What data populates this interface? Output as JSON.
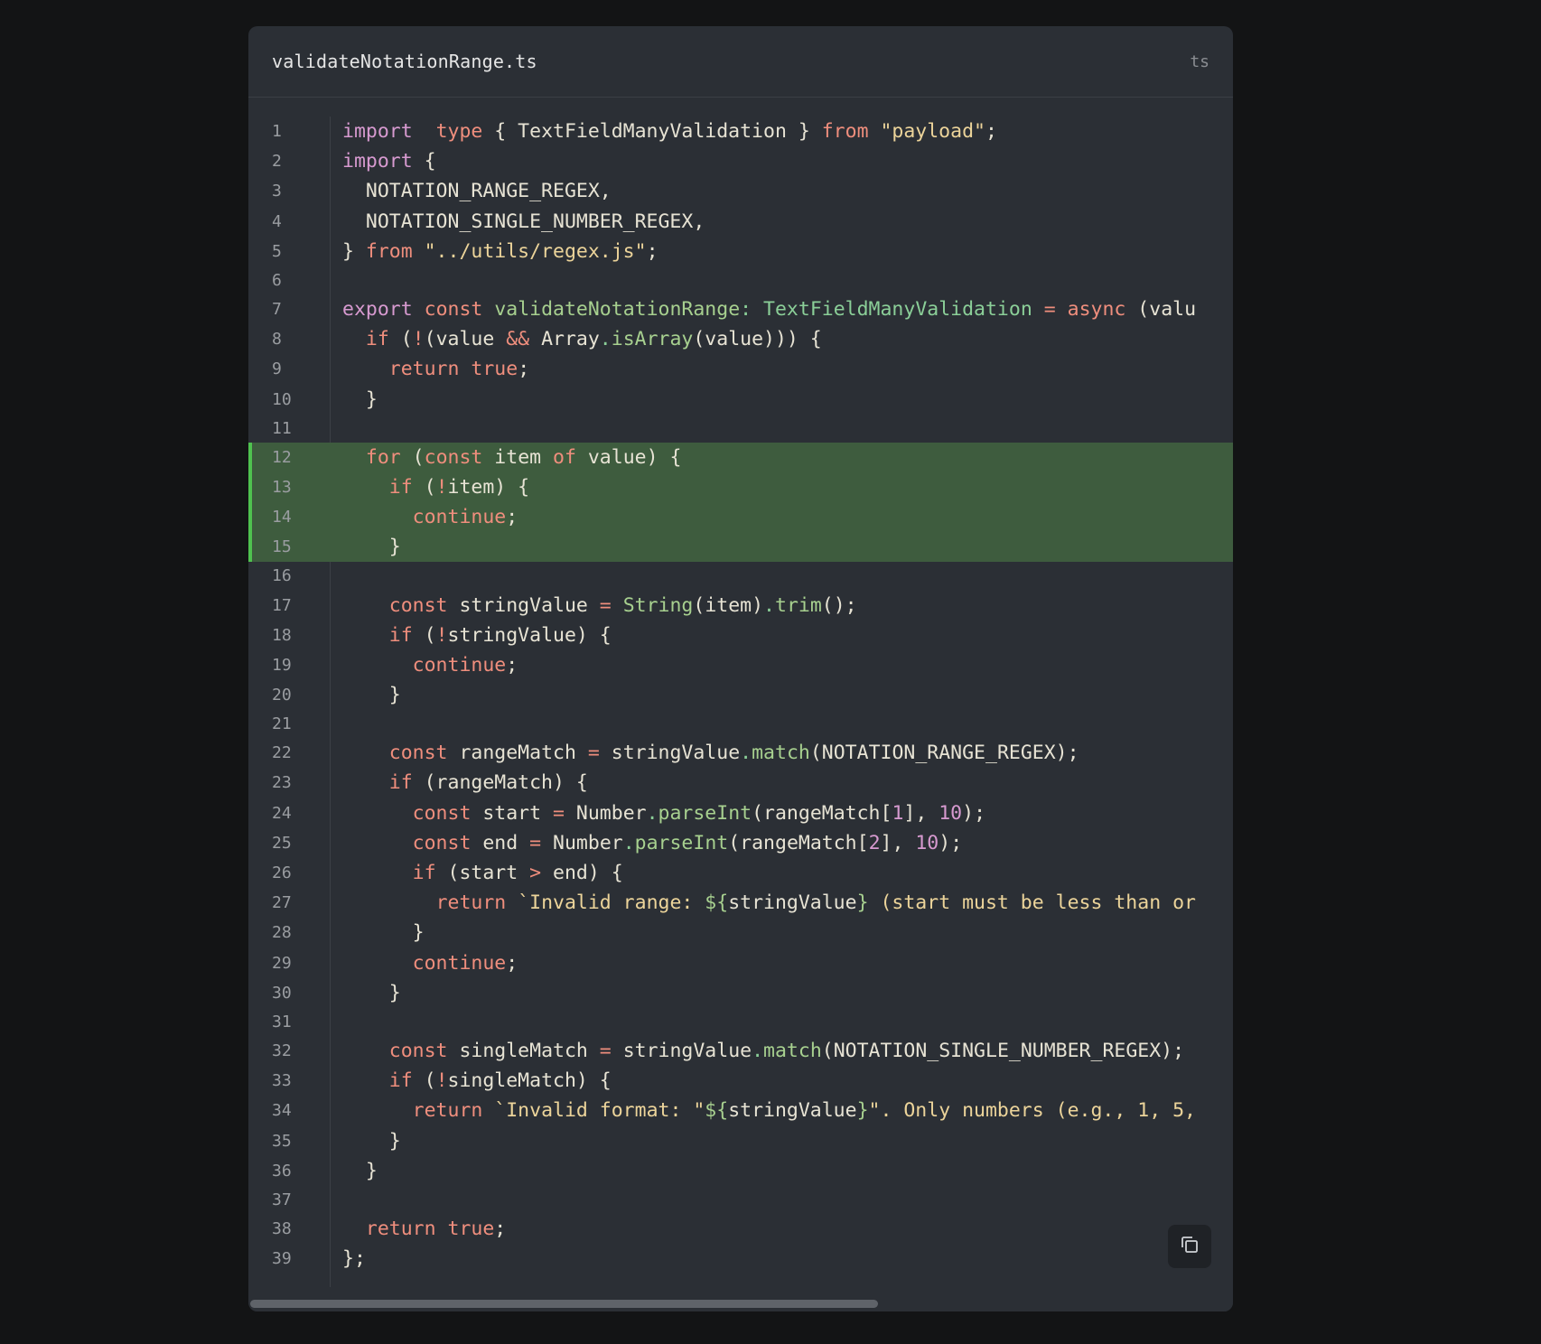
{
  "file": {
    "name": "validateNotationRange.ts",
    "lang": "ts"
  },
  "code": [
    {
      "n": "1",
      "hl": false,
      "t": [
        [
          "kw-p",
          "import"
        ],
        [
          "",
          "  "
        ],
        [
          "kw-o",
          "type"
        ],
        [
          "",
          " { TextFieldManyValidation } "
        ],
        [
          "kw-o",
          "from"
        ],
        [
          "",
          ""
        ],
        [
          "str",
          " \"payload\""
        ],
        [
          "",
          ";"
        ]
      ]
    },
    {
      "n": "2",
      "hl": false,
      "t": [
        [
          "kw-p",
          "import"
        ],
        [
          "",
          " {"
        ]
      ]
    },
    {
      "n": "3",
      "hl": false,
      "t": [
        [
          "",
          "  NOTATION_RANGE_REGEX,"
        ]
      ]
    },
    {
      "n": "4",
      "hl": false,
      "t": [
        [
          "",
          "  NOTATION_SINGLE_NUMBER_REGEX,"
        ]
      ]
    },
    {
      "n": "5",
      "hl": false,
      "t": [
        [
          "",
          "} "
        ],
        [
          "kw-o",
          "from"
        ],
        [
          "str",
          " \"../utils/regex.js\""
        ],
        [
          "",
          ";"
        ]
      ]
    },
    {
      "n": "6",
      "hl": false,
      "empty": true,
      "t": []
    },
    {
      "n": "7",
      "hl": false,
      "t": [
        [
          "kw-p",
          "export"
        ],
        [
          "",
          " "
        ],
        [
          "kw-o",
          "const"
        ],
        [
          "",
          " "
        ],
        [
          "fn",
          "validateNotationRange"
        ],
        [
          "dot",
          ":"
        ],
        [
          "",
          " "
        ],
        [
          "ty",
          "TextFieldManyValidation"
        ],
        [
          "",
          " "
        ],
        [
          "op",
          "="
        ],
        [
          "",
          " "
        ],
        [
          "kw-o",
          "async"
        ],
        [
          "",
          " (valu"
        ]
      ]
    },
    {
      "n": "8",
      "hl": false,
      "t": [
        [
          "",
          "  "
        ],
        [
          "kw-o",
          "if"
        ],
        [
          "",
          " ("
        ],
        [
          "op",
          "!"
        ],
        [
          "",
          "(value "
        ],
        [
          "op",
          "&&"
        ],
        [
          "",
          " Array"
        ],
        [
          "dot",
          "."
        ],
        [
          "fn",
          "isArray"
        ],
        [
          "",
          "(value))) {"
        ]
      ]
    },
    {
      "n": "9",
      "hl": false,
      "t": [
        [
          "",
          "    "
        ],
        [
          "kw-o",
          "return"
        ],
        [
          "",
          " "
        ],
        [
          "kw-o",
          "true"
        ],
        [
          "",
          ";"
        ]
      ]
    },
    {
      "n": "10",
      "hl": false,
      "t": [
        [
          "",
          "  }"
        ]
      ]
    },
    {
      "n": "11",
      "hl": false,
      "empty": true,
      "t": []
    },
    {
      "n": "12",
      "hl": true,
      "t": [
        [
          "",
          "  "
        ],
        [
          "kw-o",
          "for"
        ],
        [
          "",
          " ("
        ],
        [
          "kw-o",
          "const"
        ],
        [
          "",
          " item "
        ],
        [
          "kw-o",
          "of"
        ],
        [
          "",
          " value) {"
        ]
      ]
    },
    {
      "n": "13",
      "hl": true,
      "t": [
        [
          "",
          "    "
        ],
        [
          "kw-o",
          "if"
        ],
        [
          "",
          " ("
        ],
        [
          "op",
          "!"
        ],
        [
          "",
          "item) {"
        ]
      ]
    },
    {
      "n": "14",
      "hl": true,
      "t": [
        [
          "",
          "      "
        ],
        [
          "kw-o",
          "continue"
        ],
        [
          "",
          ";"
        ]
      ]
    },
    {
      "n": "15",
      "hl": true,
      "t": [
        [
          "",
          "    }"
        ]
      ]
    },
    {
      "n": "16",
      "hl": false,
      "empty": true,
      "t": []
    },
    {
      "n": "17",
      "hl": false,
      "t": [
        [
          "",
          "    "
        ],
        [
          "kw-o",
          "const"
        ],
        [
          "",
          " stringValue "
        ],
        [
          "op",
          "="
        ],
        [
          "",
          " "
        ],
        [
          "fn",
          "String"
        ],
        [
          "",
          "(item)"
        ],
        [
          "dot",
          "."
        ],
        [
          "fn",
          "trim"
        ],
        [
          "",
          "();"
        ]
      ]
    },
    {
      "n": "18",
      "hl": false,
      "t": [
        [
          "",
          "    "
        ],
        [
          "kw-o",
          "if"
        ],
        [
          "",
          " ("
        ],
        [
          "op",
          "!"
        ],
        [
          "",
          "stringValue) {"
        ]
      ]
    },
    {
      "n": "19",
      "hl": false,
      "t": [
        [
          "",
          "      "
        ],
        [
          "kw-o",
          "continue"
        ],
        [
          "",
          ";"
        ]
      ]
    },
    {
      "n": "20",
      "hl": false,
      "t": [
        [
          "",
          "    }"
        ]
      ]
    },
    {
      "n": "21",
      "hl": false,
      "empty": true,
      "t": []
    },
    {
      "n": "22",
      "hl": false,
      "t": [
        [
          "",
          "    "
        ],
        [
          "kw-o",
          "const"
        ],
        [
          "",
          " rangeMatch "
        ],
        [
          "op",
          "="
        ],
        [
          "",
          " stringValue"
        ],
        [
          "dot",
          "."
        ],
        [
          "fn",
          "match"
        ],
        [
          "",
          "(NOTATION_RANGE_REGEX);"
        ]
      ]
    },
    {
      "n": "23",
      "hl": false,
      "t": [
        [
          "",
          "    "
        ],
        [
          "kw-o",
          "if"
        ],
        [
          "",
          " (rangeMatch) {"
        ]
      ]
    },
    {
      "n": "24",
      "hl": false,
      "t": [
        [
          "",
          "      "
        ],
        [
          "kw-o",
          "const"
        ],
        [
          "",
          " start "
        ],
        [
          "op",
          "="
        ],
        [
          "",
          " Number"
        ],
        [
          "dot",
          "."
        ],
        [
          "fn",
          "parseInt"
        ],
        [
          "",
          "(rangeMatch["
        ],
        [
          "num",
          "1"
        ],
        [
          "",
          "], "
        ],
        [
          "num",
          "10"
        ],
        [
          "",
          ");"
        ]
      ]
    },
    {
      "n": "25",
      "hl": false,
      "t": [
        [
          "",
          "      "
        ],
        [
          "kw-o",
          "const"
        ],
        [
          "",
          " end "
        ],
        [
          "op",
          "="
        ],
        [
          "",
          " Number"
        ],
        [
          "dot",
          "."
        ],
        [
          "fn",
          "parseInt"
        ],
        [
          "",
          "(rangeMatch["
        ],
        [
          "num",
          "2"
        ],
        [
          "",
          "], "
        ],
        [
          "num",
          "10"
        ],
        [
          "",
          ");"
        ]
      ]
    },
    {
      "n": "26",
      "hl": false,
      "t": [
        [
          "",
          "      "
        ],
        [
          "kw-o",
          "if"
        ],
        [
          "",
          " (start "
        ],
        [
          "op",
          ">"
        ],
        [
          "",
          " end) {"
        ]
      ]
    },
    {
      "n": "27",
      "hl": false,
      "t": [
        [
          "",
          "        "
        ],
        [
          "kw-o",
          "return"
        ],
        [
          "",
          " "
        ],
        [
          "str",
          "`Invalid range: "
        ],
        [
          "fn",
          "${"
        ],
        [
          "",
          "stringValue"
        ],
        [
          "fn",
          "}"
        ],
        [
          "str",
          " (start must be less than or"
        ]
      ]
    },
    {
      "n": "28",
      "hl": false,
      "t": [
        [
          "",
          "      }"
        ]
      ]
    },
    {
      "n": "29",
      "hl": false,
      "t": [
        [
          "",
          "      "
        ],
        [
          "kw-o",
          "continue"
        ],
        [
          "",
          ";"
        ]
      ]
    },
    {
      "n": "30",
      "hl": false,
      "t": [
        [
          "",
          "    }"
        ]
      ]
    },
    {
      "n": "31",
      "hl": false,
      "empty": true,
      "t": []
    },
    {
      "n": "32",
      "hl": false,
      "t": [
        [
          "",
          "    "
        ],
        [
          "kw-o",
          "const"
        ],
        [
          "",
          " singleMatch "
        ],
        [
          "op",
          "="
        ],
        [
          "",
          " stringValue"
        ],
        [
          "dot",
          "."
        ],
        [
          "fn",
          "match"
        ],
        [
          "",
          "(NOTATION_SINGLE_NUMBER_REGEX);"
        ]
      ]
    },
    {
      "n": "33",
      "hl": false,
      "t": [
        [
          "",
          "    "
        ],
        [
          "kw-o",
          "if"
        ],
        [
          "",
          " ("
        ],
        [
          "op",
          "!"
        ],
        [
          "",
          "singleMatch) {"
        ]
      ]
    },
    {
      "n": "34",
      "hl": false,
      "t": [
        [
          "",
          "      "
        ],
        [
          "kw-o",
          "return"
        ],
        [
          "",
          " "
        ],
        [
          "str",
          "`Invalid format: \""
        ],
        [
          "fn",
          "${"
        ],
        [
          "",
          "stringValue"
        ],
        [
          "fn",
          "}"
        ],
        [
          "str",
          "\". Only numbers (e.g., 1, 5,"
        ]
      ]
    },
    {
      "n": "35",
      "hl": false,
      "t": [
        [
          "",
          "    }"
        ]
      ]
    },
    {
      "n": "36",
      "hl": false,
      "t": [
        [
          "",
          "  }"
        ]
      ]
    },
    {
      "n": "37",
      "hl": false,
      "empty": true,
      "t": []
    },
    {
      "n": "38",
      "hl": false,
      "t": [
        [
          "",
          "  "
        ],
        [
          "kw-o",
          "return"
        ],
        [
          "",
          " "
        ],
        [
          "kw-o",
          "true"
        ],
        [
          "",
          ";"
        ]
      ]
    },
    {
      "n": "39",
      "hl": false,
      "t": [
        [
          "",
          "};"
        ]
      ]
    }
  ],
  "colors": {
    "background": "#131415",
    "card": "#2b2f35",
    "highlight": "#3e5c3e",
    "highlight_bar": "#4fc24f"
  },
  "icons": {
    "copy": "copy-icon"
  }
}
